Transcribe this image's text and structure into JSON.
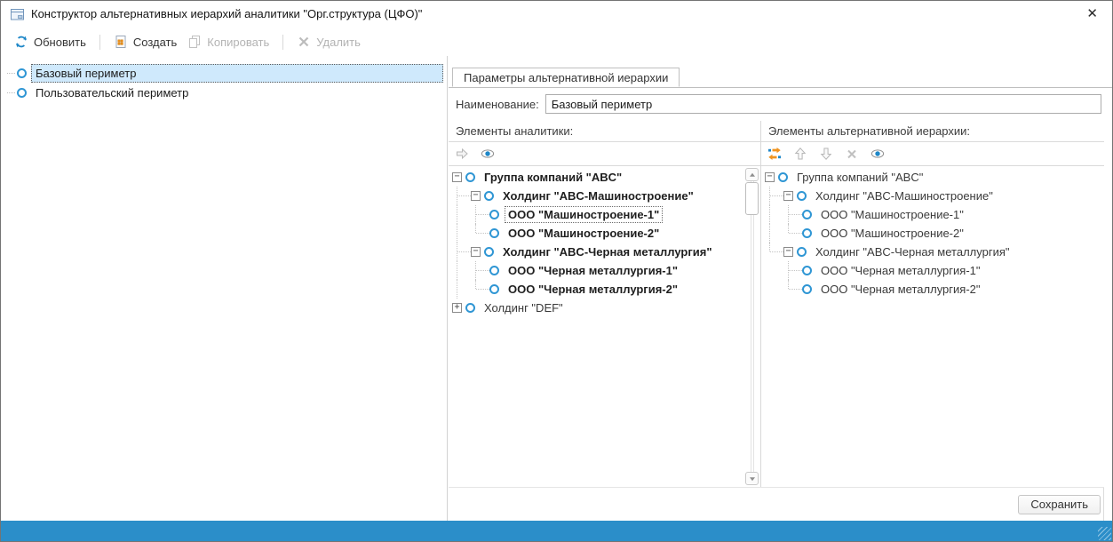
{
  "window": {
    "title": "Конструктор альтернативных иерархий аналитики \"Орг.структура (ЦФО)\"",
    "icon": "form-window-icon",
    "close": "✕"
  },
  "toolbar": {
    "buttons": [
      {
        "name": "refresh-button",
        "label": "Обновить",
        "icon": "refresh-icon",
        "enabled": true,
        "sep_before": false
      },
      {
        "name": "create-button",
        "label": "Создать",
        "icon": "create-icon",
        "enabled": true,
        "sep_before": true
      },
      {
        "name": "copy-button",
        "label": "Копировать",
        "icon": "copy-icon",
        "enabled": false,
        "sep_before": false
      },
      {
        "name": "delete-button",
        "label": "Удалить",
        "icon": "delete-icon",
        "enabled": false,
        "sep_before": true
      }
    ]
  },
  "perimeters": {
    "items": [
      {
        "label": "Базовый периметр",
        "selected": true
      },
      {
        "label": "Пользовательский периметр",
        "selected": false
      }
    ]
  },
  "tabs": {
    "active": "Параметры альтернативной иерархии"
  },
  "name_field": {
    "label": "Наименование:",
    "value": "Базовый периметр"
  },
  "analytics": {
    "header": "Элементы аналитики:",
    "toolbar": [
      {
        "name": "move-right-button",
        "icon": "move-right-icon",
        "enabled": false
      },
      {
        "name": "view-button",
        "icon": "eye-icon",
        "enabled": true
      }
    ],
    "tree": [
      {
        "label": "Группа компаний \"ABC\"",
        "guides": [],
        "expand": "minus",
        "bold": true,
        "focused": false
      },
      {
        "label": "Холдинг \"ABC-Машиностроение\"",
        "guides": [
          "t"
        ],
        "expand": "minus",
        "bold": true,
        "focused": false
      },
      {
        "label": "ООО \"Машиностроение-1\"",
        "guides": [
          "v",
          "t"
        ],
        "expand": "none",
        "bold": true,
        "focused": true
      },
      {
        "label": "ООО \"Машиностроение-2\"",
        "guides": [
          "v",
          "l"
        ],
        "expand": "none",
        "bold": true,
        "focused": false
      },
      {
        "label": "Холдинг \"ABC-Черная металлургия\"",
        "guides": [
          "t"
        ],
        "expand": "minus",
        "bold": true,
        "focused": false
      },
      {
        "label": "ООО \"Черная металлургия-1\"",
        "guides": [
          "v",
          "t"
        ],
        "expand": "none",
        "bold": true,
        "focused": false
      },
      {
        "label": "ООО \"Черная металлургия-2\"",
        "guides": [
          "v",
          "l"
        ],
        "expand": "none",
        "bold": true,
        "focused": false
      },
      {
        "label": "Холдинг \"DEF\"",
        "guides": [],
        "expand": "plus",
        "bold": false,
        "focused": false
      }
    ]
  },
  "hierarchy": {
    "header": "Элементы альтернативной иерархии:",
    "toolbar": [
      {
        "name": "swap-level-button",
        "icon": "swap-icon",
        "enabled": true
      },
      {
        "name": "move-up-button",
        "icon": "move-up-icon",
        "enabled": false
      },
      {
        "name": "move-down-button",
        "icon": "move-down-icon",
        "enabled": false
      },
      {
        "name": "remove-button",
        "icon": "remove-icon",
        "enabled": false
      },
      {
        "name": "view-button",
        "icon": "eye-icon",
        "enabled": true
      }
    ],
    "tree": [
      {
        "label": "Группа компаний \"ABC\"",
        "guides": [],
        "expand": "minus",
        "bold": false,
        "focused": false
      },
      {
        "label": "Холдинг \"ABC-Машиностроение\"",
        "guides": [
          "t"
        ],
        "expand": "minus",
        "bold": false,
        "focused": false
      },
      {
        "label": "ООО \"Машиностроение-1\"",
        "guides": [
          "v",
          "t"
        ],
        "expand": "none",
        "bold": false,
        "focused": false
      },
      {
        "label": "ООО \"Машиностроение-2\"",
        "guides": [
          "v",
          "l"
        ],
        "expand": "none",
        "bold": false,
        "focused": false
      },
      {
        "label": "Холдинг \"ABC-Черная металлургия\"",
        "guides": [
          "l"
        ],
        "expand": "minus",
        "bold": false,
        "focused": false
      },
      {
        "label": "ООО \"Черная металлургия-1\"",
        "guides": [
          "e",
          "t"
        ],
        "expand": "none",
        "bold": false,
        "focused": false
      },
      {
        "label": "ООО \"Черная металлургия-2\"",
        "guides": [
          "e",
          "l"
        ],
        "expand": "none",
        "bold": false,
        "focused": false
      }
    ]
  },
  "footer": {
    "save_label": "Сохранить"
  },
  "colors": {
    "accent": "#1e87c8",
    "selection": "#cfe9fc",
    "statusbar": "#2b8ec9",
    "node_ring": "#2f96d4",
    "icon_orange": "#f0941f"
  }
}
